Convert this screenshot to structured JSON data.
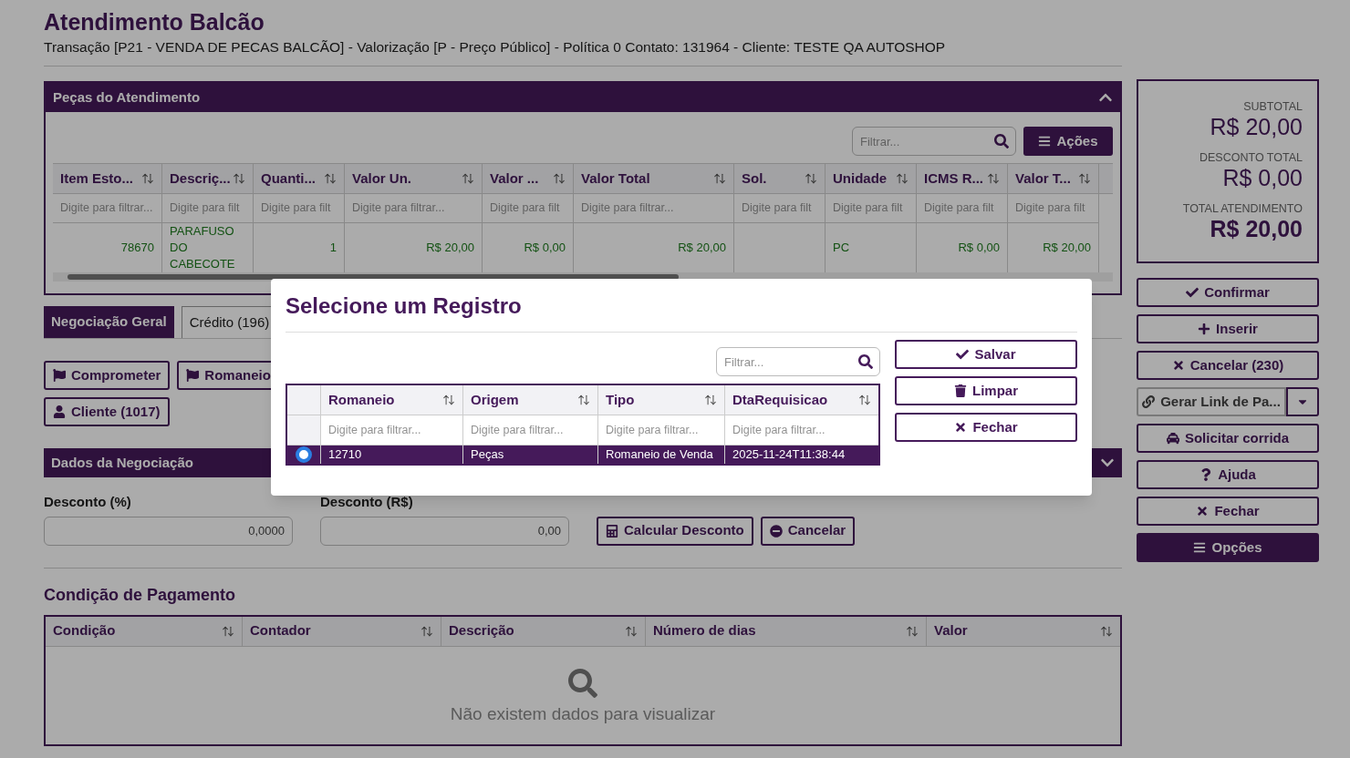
{
  "header": {
    "title": "Atendimento Balcão",
    "subtitle": "Transação [P21 - VENDA DE PECAS BALCÃO] - Valorização [P - Preço Público] - Política 0 Contato: 131964 - Cliente: TESTE QA AUTOSHOP"
  },
  "parts_panel": {
    "title": "Peças do Atendimento",
    "expanded": true,
    "filter": {
      "placeholder": "Filtrar..."
    },
    "actions_button": "Ações",
    "columns": [
      {
        "label": "Item Esto...",
        "placeholder": "Digite para filtrar..."
      },
      {
        "label": "Descriç...",
        "placeholder": "Digite para filt"
      },
      {
        "label": "Quanti...",
        "placeholder": "Digite para filt"
      },
      {
        "label": "Valor Un.",
        "placeholder": "Digite para filtrar..."
      },
      {
        "label": "Valor ...",
        "placeholder": "Digite para filt"
      },
      {
        "label": "Valor Total",
        "placeholder": "Digite para filtrar..."
      },
      {
        "label": "Sol.",
        "placeholder": "Digite para filt"
      },
      {
        "label": "Unidade",
        "placeholder": "Digite para filt"
      },
      {
        "label": "ICMS R...",
        "placeholder": "Digite para filt"
      },
      {
        "label": "Valor T...",
        "placeholder": "Digite para filt"
      }
    ],
    "rows": [
      {
        "cells": [
          "78670",
          "PARAFUSO DO CABECOTE",
          "1",
          "R$ 20,00",
          "R$ 0,00",
          "R$ 20,00",
          "",
          "PC",
          "R$ 0,00",
          "R$ 20,00"
        ]
      }
    ]
  },
  "tabs": [
    {
      "label": "Negociação Geral",
      "selected": true
    },
    {
      "label": "Crédito (196)",
      "selected": false
    }
  ],
  "action_buttons": [
    "Comprometer",
    "Romaneio",
    "Cliente (1017)"
  ],
  "negotiation": {
    "title": "Dados da Negociação",
    "expanded": false,
    "fields": [
      {
        "label": "Desconto (%)",
        "value": "0,0000"
      },
      {
        "label": "Desconto (R$)",
        "value": "0,00"
      }
    ],
    "buttons": [
      "Calcular Desconto",
      "Cancelar"
    ]
  },
  "payment": {
    "title": "Condição de Pagamento",
    "columns": [
      "Condição",
      "Contador",
      "Descrição",
      "Número de dias",
      "Valor"
    ],
    "empty_text": "Não existem dados para visualizar"
  },
  "summary": [
    {
      "label": "SUBTOTAL",
      "value": "R$ 20,00",
      "kind": "normal"
    },
    {
      "label": "DESCONTO TOTAL",
      "value": "R$ 0,00",
      "kind": "normal"
    },
    {
      "label": "TOTAL ATENDIMENTO",
      "value": "R$ 20,00",
      "kind": "total"
    }
  ],
  "side_buttons": [
    {
      "label": "Confirmar",
      "kind": "outline"
    },
    {
      "label": "Inserir",
      "kind": "outline"
    },
    {
      "label": "Cancelar (230)",
      "kind": "outline"
    },
    {
      "label": "Gerar Link de Pa...",
      "kind": "split"
    },
    {
      "label": "Solicitar corrida",
      "kind": "outline"
    },
    {
      "label": "Ajuda",
      "kind": "outline"
    },
    {
      "label": "Fechar",
      "kind": "outline"
    },
    {
      "label": "Opções",
      "kind": "solid"
    }
  ],
  "modal": {
    "title": "Selecione um Registro",
    "filter": {
      "placeholder": "Filtrar..."
    },
    "buttons": [
      "Salvar",
      "Limpar",
      "Fechar"
    ],
    "columns": [
      {
        "label": "Romaneio",
        "placeholder": "Digite para filtrar..."
      },
      {
        "label": "Origem",
        "placeholder": "Digite para filtrar..."
      },
      {
        "label": "Tipo",
        "placeholder": "Digite para filtrar..."
      },
      {
        "label": "DtaRequisicao",
        "placeholder": "Digite para filtrar..."
      }
    ],
    "rows": [
      {
        "selected": true,
        "cells": [
          "12710",
          "Peças",
          "Romaneio de Venda",
          "2025-11-24T11:38:44"
        ]
      }
    ]
  }
}
